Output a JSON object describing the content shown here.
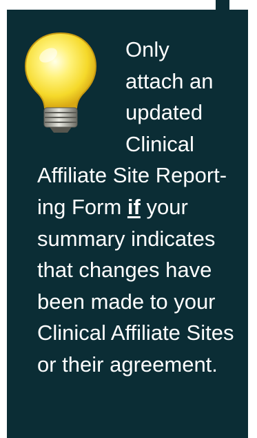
{
  "tip": {
    "icon": "lightbulb-icon",
    "lines": [
      "Only",
      "attach an",
      "updated",
      "Clinical",
      "Affiliate Site Report-"
    ],
    "line6_before": "ing Form ",
    "line6_emphasis": "if",
    "line6_after": " your",
    "lines_after": [
      "summary indicates",
      "that changes have",
      "been made to your",
      "Clinical Affiliate Sites",
      "or their agreement."
    ]
  },
  "colors": {
    "panel_background": "#0b2d35",
    "text": "#ffffff",
    "bulb_glow": "#f7e23a"
  }
}
